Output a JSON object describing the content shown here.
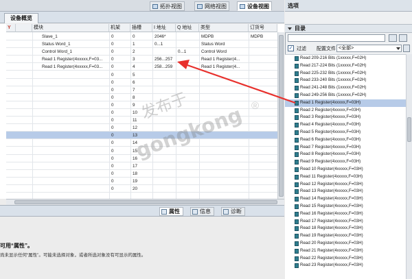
{
  "view_tabs": {
    "topology": "拓扑视图",
    "network": "网络视图",
    "device": "设备视图"
  },
  "overview_tab": "设备概览",
  "table": {
    "headers": [
      "模块",
      "机架",
      "插槽",
      "I 地址",
      "Q 地址",
      "类型",
      "订货号"
    ],
    "rows": [
      {
        "module": "Slave_1",
        "rack": "0",
        "slot": "0",
        "i_addr": "2046*",
        "q_addr": "",
        "type": "MDPB",
        "order": "MDPB"
      },
      {
        "module": "Status Word_1",
        "rack": "0",
        "slot": "1",
        "i_addr": "0...1",
        "q_addr": "",
        "type": "Status Word",
        "order": ""
      },
      {
        "module": "Control Word_1",
        "rack": "0",
        "slot": "2",
        "i_addr": "",
        "q_addr": "0...1",
        "type": "Control Word",
        "order": ""
      },
      {
        "module": "Read 1 Register(4xxxxx,F=03...",
        "rack": "0",
        "slot": "3",
        "i_addr": "256...257",
        "q_addr": "",
        "type": "Read 1 Register(4...",
        "order": ""
      },
      {
        "module": "Read 1 Register(4xxxxx,F=03...",
        "rack": "0",
        "slot": "4",
        "i_addr": "258...259",
        "q_addr": "",
        "type": "Read 1 Register(4...",
        "order": ""
      },
      {
        "module": "",
        "rack": "0",
        "slot": "5",
        "i_addr": "",
        "q_addr": "",
        "type": "",
        "order": ""
      },
      {
        "module": "",
        "rack": "0",
        "slot": "6",
        "i_addr": "",
        "q_addr": "",
        "type": "",
        "order": ""
      },
      {
        "module": "",
        "rack": "0",
        "slot": "7",
        "i_addr": "",
        "q_addr": "",
        "type": "",
        "order": ""
      },
      {
        "module": "",
        "rack": "0",
        "slot": "8",
        "i_addr": "",
        "q_addr": "",
        "type": "",
        "order": ""
      },
      {
        "module": "",
        "rack": "0",
        "slot": "9",
        "i_addr": "",
        "q_addr": "",
        "type": "",
        "order": ""
      },
      {
        "module": "",
        "rack": "0",
        "slot": "10",
        "i_addr": "",
        "q_addr": "",
        "type": "",
        "order": ""
      },
      {
        "module": "",
        "rack": "0",
        "slot": "11",
        "i_addr": "",
        "q_addr": "",
        "type": "",
        "order": ""
      },
      {
        "module": "",
        "rack": "0",
        "slot": "12",
        "i_addr": "",
        "q_addr": "",
        "type": "",
        "order": ""
      },
      {
        "module": "",
        "rack": "0",
        "slot": "13",
        "i_addr": "",
        "q_addr": "",
        "type": "",
        "order": ""
      },
      {
        "module": "",
        "rack": "0",
        "slot": "14",
        "i_addr": "",
        "q_addr": "",
        "type": "",
        "order": ""
      },
      {
        "module": "",
        "rack": "0",
        "slot": "15",
        "i_addr": "",
        "q_addr": "",
        "type": "",
        "order": ""
      },
      {
        "module": "",
        "rack": "0",
        "slot": "16",
        "i_addr": "",
        "q_addr": "",
        "type": "",
        "order": ""
      },
      {
        "module": "",
        "rack": "0",
        "slot": "17",
        "i_addr": "",
        "q_addr": "",
        "type": "",
        "order": ""
      },
      {
        "module": "",
        "rack": "0",
        "slot": "18",
        "i_addr": "",
        "q_addr": "",
        "type": "",
        "order": ""
      },
      {
        "module": "",
        "rack": "0",
        "slot": "19",
        "i_addr": "",
        "q_addr": "",
        "type": "",
        "order": ""
      },
      {
        "module": "",
        "rack": "0",
        "slot": "20",
        "i_addr": "",
        "q_addr": "",
        "type": "",
        "order": ""
      }
    ],
    "selected_slot": "13"
  },
  "properties": {
    "tabs": [
      "属性",
      "信息",
      "诊断"
    ],
    "title": "可用“属性”。",
    "desc": "尚未显示任何“属性”。可能未选择对象，或者所选对象没有可显示的属性。"
  },
  "right_panel": {
    "title": "选项",
    "catalog_title": "目录",
    "filter_label": "过滤",
    "profile_label": "配置文件",
    "profile_value": "<全部>",
    "items": [
      "Read 209-216 Bits (1xxxxx,F=02H)",
      "Read 217-224 Bits (1xxxxx,F=02H)",
      "Read 225-232 Bits (1xxxxx,F=02H)",
      "Read 233-240 Bits (1xxxxx,F=02H)",
      "Read 241-248 Bits (1xxxxx,F=02H)",
      "Read 249-256 Bits (1xxxxx,F=02H)",
      "Read 1 Register(4xxxxx,F=03H)",
      "Read 2 Register(4xxxxx,F=03H)",
      "Read 3 Register(4xxxxx,F=03H)",
      "Read 4 Register(4xxxxx,F=03H)",
      "Read 5 Register(4xxxxx,F=03H)",
      "Read 6 Register(4xxxxx,F=03H)",
      "Read 7 Register(4xxxxx,F=03H)",
      "Read 8 Register(4xxxxx,F=03H)",
      "Read 9 Register(4xxxxx,F=03H)",
      "Read 10 Register(4xxxxx,F=03H)",
      "Read 11 Register(4xxxxx,F=03H)",
      "Read 12 Register(4xxxxx,F=03H)",
      "Read 13 Register(4xxxxx,F=03H)",
      "Read 14 Register(4xxxxx,F=03H)",
      "Read 15 Register(4xxxxx,F=03H)",
      "Read 16 Register(4xxxxx,F=03H)",
      "Read 17 Register(4xxxxx,F=03H)",
      "Read 18 Register(4xxxxx,F=03H)",
      "Read 19 Register(4xxxxx,F=03H)",
      "Read 20 Register(4xxxxx,F=03H)",
      "Read 21 Register(4xxxxx,F=03H)",
      "Read 22 Register(4xxxxx,F=03H)",
      "Read 23 Register(4xxxxx,F=03H)"
    ],
    "selected_item": "Read 1 Register(4xxxxx,F=03H)"
  },
  "watermark": {
    "line1": "发布于",
    "line2": "gongkong",
    "mark": "®"
  },
  "colors": {
    "selection": "#b7cbe8",
    "arrow": "#e8302c",
    "module_icon": "#2f7d8e"
  },
  "icons": [
    "topology-view-icon",
    "network-view-icon",
    "device-view-icon",
    "properties-icon",
    "info-icon",
    "diagnostics-icon",
    "catalog-search-icon",
    "hardware-module-icon"
  ]
}
